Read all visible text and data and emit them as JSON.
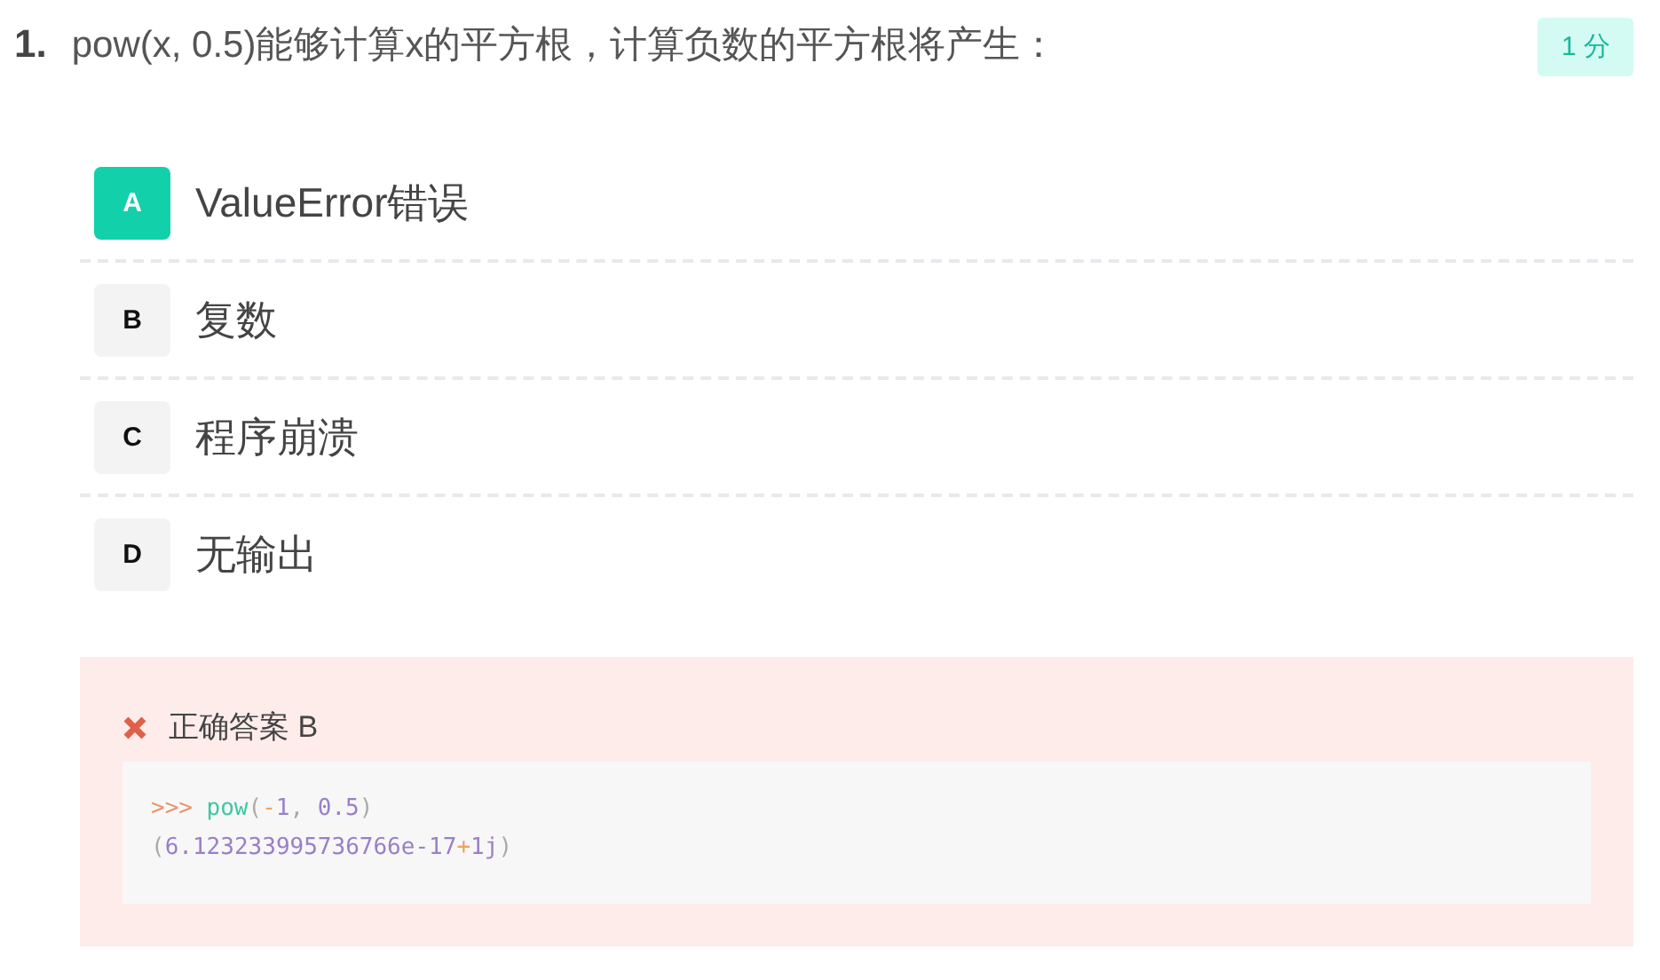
{
  "question": {
    "number": "1.",
    "text": "pow(x, 0.5)能够计算x的平方根，计算负数的平方根将产生：",
    "score": "1 分"
  },
  "options": [
    {
      "letter": "A",
      "text": "ValueError错误",
      "selected": true
    },
    {
      "letter": "B",
      "text": "复数",
      "selected": false
    },
    {
      "letter": "C",
      "text": "程序崩溃",
      "selected": false
    },
    {
      "letter": "D",
      "text": "无输出",
      "selected": false
    }
  ],
  "feedback": {
    "correct": false,
    "answer": "正确答案 B",
    "code_lines": [
      [
        {
          "kind": "prompt",
          "text": ">>>"
        },
        {
          "kind": "func",
          "text": "pow"
        },
        {
          "kind": "punct",
          "text": "("
        },
        {
          "kind": "op",
          "text": "-"
        },
        {
          "kind": "number",
          "text": "1"
        },
        {
          "kind": "punct",
          "text": ", "
        },
        {
          "kind": "number",
          "text": "0.5"
        },
        {
          "kind": "punct",
          "text": ")"
        }
      ],
      [
        {
          "kind": "punct",
          "text": "("
        },
        {
          "kind": "number",
          "text": "6.123233995736766e-17"
        },
        {
          "kind": "op",
          "text": "+"
        },
        {
          "kind": "number",
          "text": "1j"
        },
        {
          "kind": "punct",
          "text": ")"
        }
      ]
    ]
  }
}
